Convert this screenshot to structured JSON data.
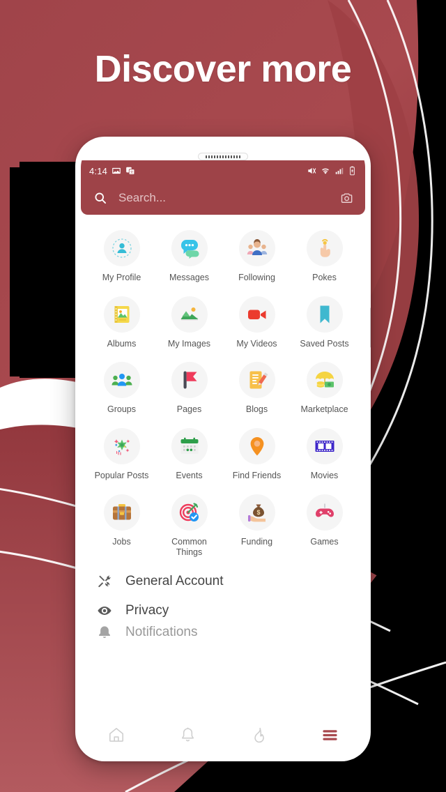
{
  "colors": {
    "brand_red": "#a8494e",
    "brand_red_dark": "#8f3238",
    "app_bar": "#9e4348",
    "tile_bg": "#f5f5f5",
    "label_gray": "#555555",
    "background_black": "#000000",
    "white": "#ffffff"
  },
  "headline": "Discover more",
  "phone": {
    "speaker": "speaker-grille",
    "statusbar": {
      "time": "4:14",
      "left_icons": [
        "image-icon",
        "translate-icon"
      ],
      "right_icons": [
        "mute-icon",
        "wifi-icon",
        "signal-icon",
        "battery-charging-icon"
      ]
    },
    "search": {
      "placeholder": "Search...",
      "value": "",
      "search_icon": "search-icon",
      "camera_icon": "camera-icon"
    },
    "grid": [
      {
        "label": "My Profile",
        "icon": "person-icon"
      },
      {
        "label": "Messages",
        "icon": "chat-bubble-icon"
      },
      {
        "label": "Following",
        "icon": "people-group-icon"
      },
      {
        "label": "Pokes",
        "icon": "hand-tap-icon"
      },
      {
        "label": "Albums",
        "icon": "photo-album-icon"
      },
      {
        "label": "My Images",
        "icon": "landscape-photo-icon"
      },
      {
        "label": "My Videos",
        "icon": "video-camera-icon"
      },
      {
        "label": "Saved Posts",
        "icon": "bookmark-icon"
      },
      {
        "label": "Groups",
        "icon": "group-users-icon"
      },
      {
        "label": "Pages",
        "icon": "flag-icon"
      },
      {
        "label": "Blogs",
        "icon": "note-pencil-icon"
      },
      {
        "label": "Marketplace",
        "icon": "umbrella-money-icon"
      },
      {
        "label": "Popular Posts",
        "icon": "sparkle-burst-icon"
      },
      {
        "label": "Events",
        "icon": "calendar-icon"
      },
      {
        "label": "Find Friends",
        "icon": "map-pin-icon"
      },
      {
        "label": "Movies",
        "icon": "film-strip-icon"
      },
      {
        "label": "Jobs",
        "icon": "briefcase-icon"
      },
      {
        "label": "Common Things",
        "icon": "target-check-icon"
      },
      {
        "label": "Funding",
        "icon": "money-bag-hand-icon"
      },
      {
        "label": "Games",
        "icon": "gamepad-icon"
      }
    ],
    "settings_list": [
      {
        "label": "General Account",
        "icon": "tools-icon"
      },
      {
        "label": "Privacy",
        "icon": "eye-icon"
      },
      {
        "label": "Notifications",
        "icon": "bell-icon"
      }
    ],
    "bottom_nav": [
      {
        "name": "home",
        "icon": "home-icon",
        "active": false
      },
      {
        "name": "notifications",
        "icon": "bell-icon",
        "active": false
      },
      {
        "name": "trending",
        "icon": "flame-icon",
        "active": false
      },
      {
        "name": "menu",
        "icon": "hamburger-icon",
        "active": true
      }
    ]
  }
}
